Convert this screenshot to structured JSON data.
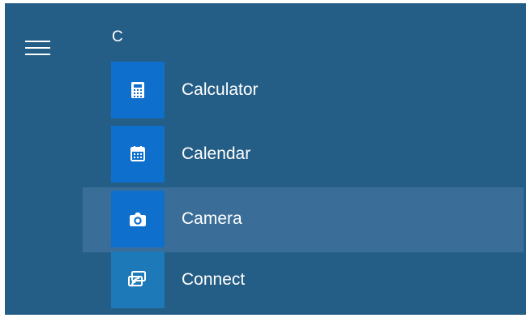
{
  "window": {
    "title": ""
  },
  "sidebar": {
    "menu_icon": "hamburger-menu-icon"
  },
  "apps": {
    "group_letter": "C",
    "items": [
      {
        "label": "Calculator",
        "icon": "calculator-icon",
        "tile_color": "#0f6fcc",
        "hovered": false
      },
      {
        "label": "Calendar",
        "icon": "calendar-icon",
        "tile_color": "#0f6fcc",
        "hovered": false
      },
      {
        "label": "Camera",
        "icon": "camera-icon",
        "tile_color": "#0f6fcc",
        "hovered": true
      },
      {
        "label": "Connect",
        "icon": "connect-icon",
        "tile_color": "#1d79b8",
        "hovered": false
      }
    ]
  },
  "colors": {
    "background": "#245e86",
    "hover_background": "#3a6e98",
    "tile_blue": "#0f6fcc",
    "text": "#ffffff"
  }
}
